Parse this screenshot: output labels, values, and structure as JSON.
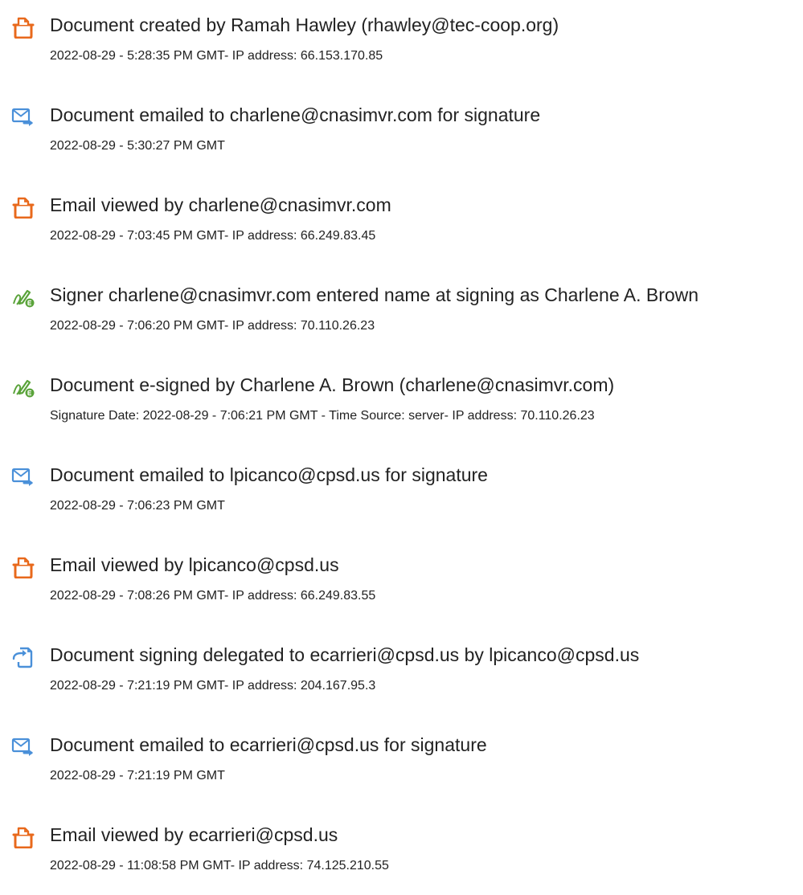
{
  "events": [
    {
      "icon": "document-created-icon",
      "title": "Document created by Ramah Hawley (rhawley@tec-coop.org)",
      "detail": "2022-08-29 - 5:28:35 PM GMT- IP address: 66.153.170.85"
    },
    {
      "icon": "email-sent-icon",
      "title": "Document emailed to charlene@cnasimvr.com for signature",
      "detail": "2022-08-29 - 5:30:27 PM GMT"
    },
    {
      "icon": "document-viewed-icon",
      "title": "Email viewed by charlene@cnasimvr.com",
      "detail": "2022-08-29 - 7:03:45 PM GMT- IP address: 66.249.83.45"
    },
    {
      "icon": "signature-icon",
      "title": "Signer charlene@cnasimvr.com entered name at signing as Charlene A. Brown",
      "detail": "2022-08-29 - 7:06:20 PM GMT- IP address: 70.110.26.23"
    },
    {
      "icon": "signature-icon",
      "title": "Document e-signed by Charlene A. Brown (charlene@cnasimvr.com)",
      "detail": "Signature Date: 2022-08-29 - 7:06:21 PM GMT - Time Source: server- IP address: 70.110.26.23"
    },
    {
      "icon": "email-sent-icon",
      "title": "Document emailed to lpicanco@cpsd.us for signature",
      "detail": "2022-08-29 - 7:06:23 PM GMT"
    },
    {
      "icon": "document-viewed-icon",
      "title": "Email viewed by lpicanco@cpsd.us",
      "detail": "2022-08-29 - 7:08:26 PM GMT- IP address: 66.249.83.55"
    },
    {
      "icon": "delegation-icon",
      "title": "Document signing delegated to ecarrieri@cpsd.us by lpicanco@cpsd.us",
      "detail": "2022-08-29 - 7:21:19 PM GMT- IP address: 204.167.95.3"
    },
    {
      "icon": "email-sent-icon",
      "title": "Document emailed to ecarrieri@cpsd.us for signature",
      "detail": "2022-08-29 - 7:21:19 PM GMT"
    },
    {
      "icon": "document-viewed-icon",
      "title": "Email viewed by ecarrieri@cpsd.us",
      "detail": "2022-08-29 - 11:08:58 PM GMT- IP address: 74.125.210.55"
    }
  ],
  "colors": {
    "document_icon": "#e8691c",
    "email_icon": "#4a90d9",
    "signature_icon": "#5aa33a",
    "text": "#222222"
  }
}
